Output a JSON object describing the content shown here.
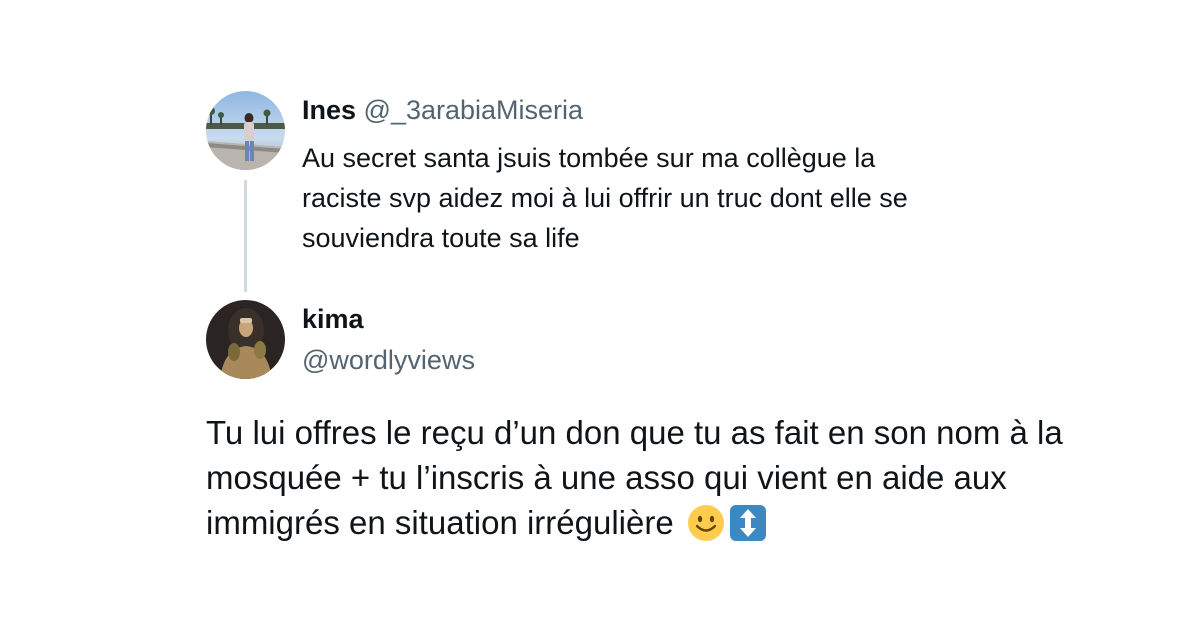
{
  "thread": {
    "original": {
      "display_name": "Ines",
      "handle": "@_3arabiaMiseria",
      "text": "Au secret santa jsuis tombée sur ma collègue la\nraciste svp aidez moi à lui offrir un truc dont elle se\nsouviendra toute sa life",
      "avatar_icon": "profile-photo"
    },
    "reply": {
      "display_name": "kima",
      "handle": "@wordlyviews",
      "text": "Tu lui offres le reçu d’un don que tu as fait en son nom à la mosquée + tu l’inscris à une asso qui vient en aide aux immigrés en situation irrégulière",
      "emojis": [
        "slightly-smiling-face-icon",
        "up-down-arrow-icon"
      ],
      "avatar_icon": "profile-photo"
    }
  },
  "colors": {
    "text_primary": "#0f1419",
    "text_secondary": "#536471",
    "thread_line": "#cfd9de",
    "background": "#ffffff"
  }
}
